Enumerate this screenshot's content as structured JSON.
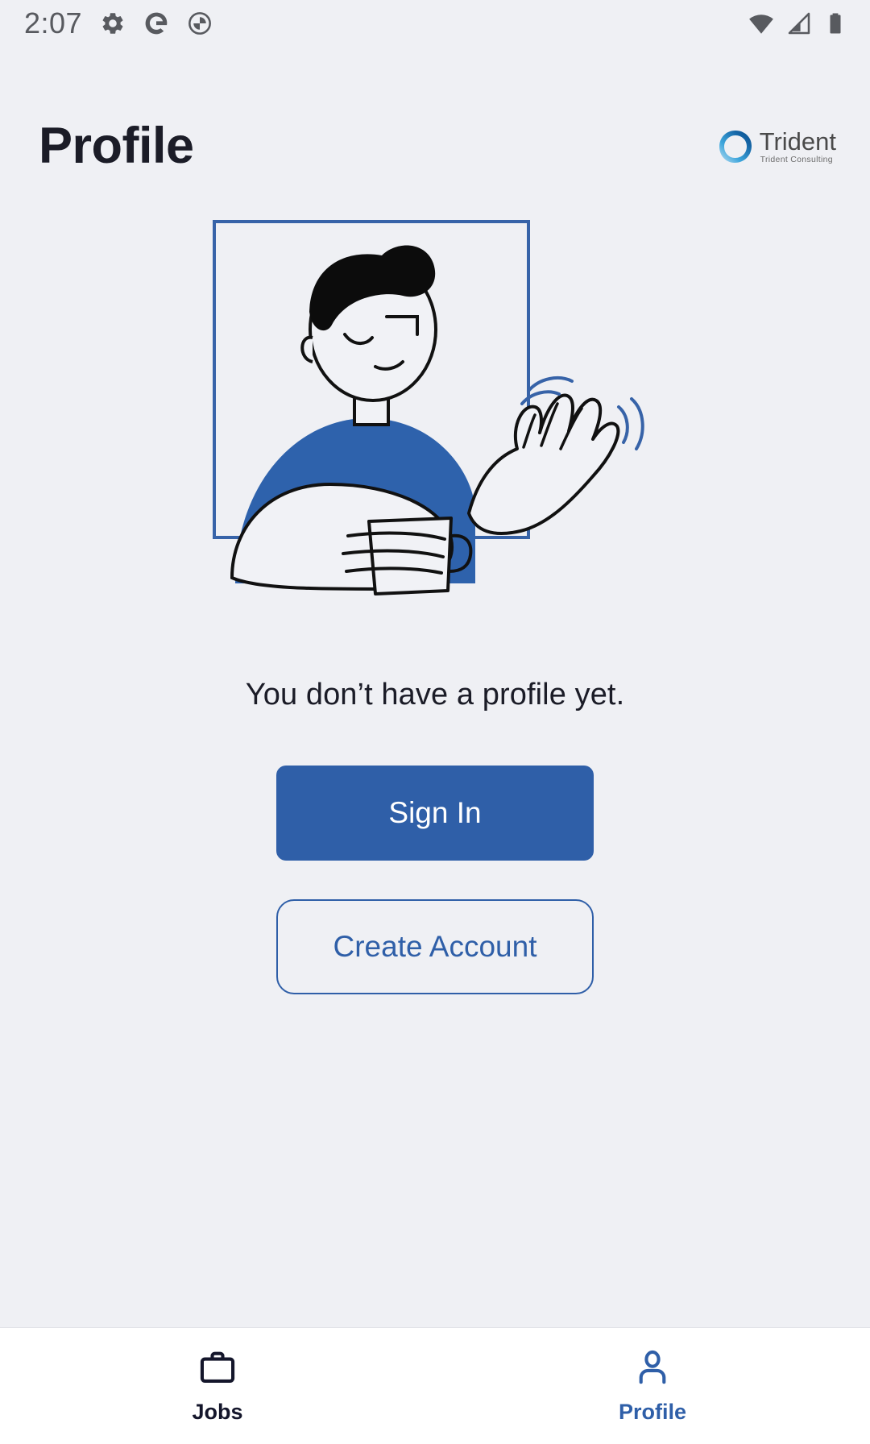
{
  "status_bar": {
    "time": "2:07",
    "left_icons": [
      "gear-icon",
      "google-g-icon",
      "do-not-disturb-icon"
    ],
    "right_icons": [
      "wifi-icon",
      "cellular-signal-icon",
      "battery-icon"
    ]
  },
  "header": {
    "title": "Profile",
    "brand": {
      "name": "Trident",
      "tagline": "Trident Consulting",
      "mark": "trident-ring-logo"
    }
  },
  "main": {
    "illustration": "person-waving-with-mug-illustration",
    "empty_message": "You don’t have a profile yet.",
    "sign_in_label": "Sign In",
    "create_account_label": "Create Account"
  },
  "bottom_nav": {
    "items": [
      {
        "label": "Jobs",
        "icon": "briefcase-icon",
        "active": false
      },
      {
        "label": "Profile",
        "icon": "person-icon",
        "active": true
      }
    ]
  },
  "colors": {
    "background": "#eff0f4",
    "primary_blue": "#2f5fa8",
    "shirt_blue": "#2e62ac",
    "text_dark": "#1b1c27",
    "nav_surface": "#ffffff",
    "status_icon": "#585a5f"
  }
}
